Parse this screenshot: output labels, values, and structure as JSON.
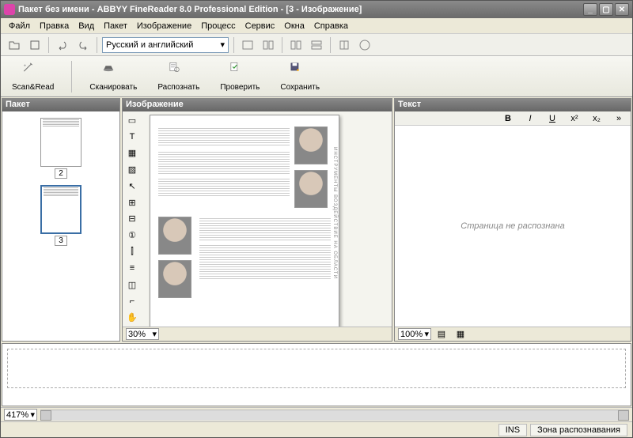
{
  "title": "Пакет без имени - ABBYY FineReader 8.0 Professional Edition - [3 - Изображение]",
  "menu": [
    "Файл",
    "Правка",
    "Вид",
    "Пакет",
    "Изображение",
    "Процесс",
    "Сервис",
    "Окна",
    "Справка"
  ],
  "language": "Русский и английский",
  "bigButtons": {
    "scanread": "Scan&Read",
    "scan": "Сканировать",
    "recognize": "Распознать",
    "check": "Проверить",
    "save": "Сохранить"
  },
  "panes": {
    "batch": "Пакет",
    "image": "Изображение",
    "text": "Текст"
  },
  "thumbs": [
    {
      "num": "2",
      "selected": false
    },
    {
      "num": "3",
      "selected": true
    }
  ],
  "textPane": {
    "message": "Страница не распознана"
  },
  "zoom": {
    "image": "30%",
    "text": "100%",
    "bottom": "417%"
  },
  "status": {
    "ins": "INS",
    "zone": "Зона распознавания"
  },
  "docSideText": "ИНСТРУМЕНТЫ   ВОЗДЕЙСТВИЕ НА ОБЛАСТИ"
}
